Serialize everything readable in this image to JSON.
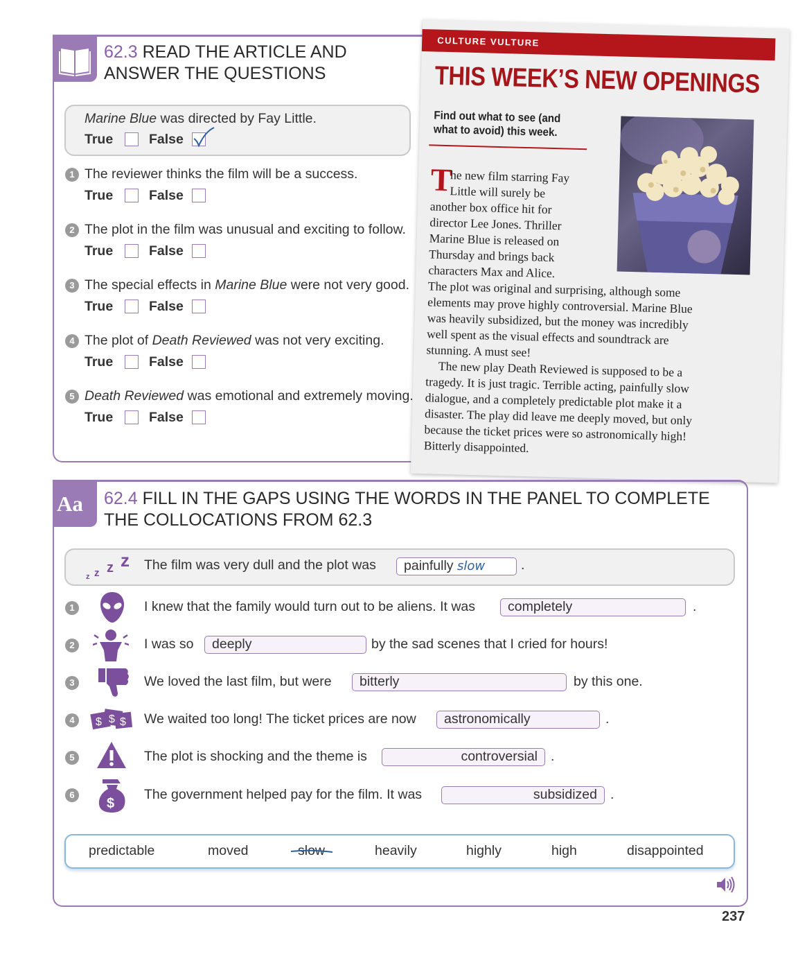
{
  "sec623": {
    "number": "62.3",
    "title_line1": "READ THE ARTICLE AND",
    "title_line2": "ANSWER THE QUESTIONS",
    "true_label": "True",
    "false_label": "False",
    "example": {
      "italic": "Marine Blue",
      "rest": " was directed by Fay Little.",
      "answer": "False"
    },
    "questions": [
      {
        "num": "1",
        "pre": "The reviewer thinks the film will be a success.",
        "italic": "",
        "post": ""
      },
      {
        "num": "2",
        "pre": "The plot in the film was unusual and exciting to follow.",
        "italic": "",
        "post": ""
      },
      {
        "num": "3",
        "pre": "The special effects in ",
        "italic": "Marine Blue",
        "post": " were not very good."
      },
      {
        "num": "4",
        "pre": "The plot of ",
        "italic": "Death Reviewed",
        "post": " was not very exciting."
      },
      {
        "num": "5",
        "pre": "",
        "italic": "Death Reviewed",
        "post": " was emotional and extremely moving."
      }
    ]
  },
  "article": {
    "banner": "CULTURE VULTURE",
    "headline": "THIS WEEK’S NEW OPENINGS",
    "standfirst": "Find out what to see (and what to avoid) this week.",
    "dropcap": "T",
    "p1_lines": [
      "he new film starring Fay",
      "Little will surely be",
      "another box office hit for",
      "director Lee Jones. Thriller",
      "Marine Blue is released on",
      "Thursday and brings back",
      "characters Max and Alice."
    ],
    "p2_lines": [
      "The plot was original and surprising, although some",
      "elements may prove highly controversial. Marine Blue",
      "was heavily subsidized, but the money was incredibly",
      "well spent as the visual effects and soundtrack are",
      "stunning. A must see!"
    ],
    "p3_lines": [
      "The new play Death Reviewed is supposed to be a",
      "tragedy. It is just tragic. Terrible acting, painfully slow",
      "dialogue, and a completely predictable plot make it a",
      "disaster. The play did leave me deeply moved, but only",
      "because the ticket prices were so astronomically high!",
      "Bitterly disappointed."
    ]
  },
  "sec624": {
    "tab_label": "Aa",
    "number": "62.4",
    "title_line1": "FILL IN THE GAPS USING THE WORDS IN THE PANEL TO COMPLETE",
    "title_line2": "THE COLLOCATIONS FROM 62.3",
    "example": {
      "text": "The film was very dull and the plot was",
      "answer_prefix": "painfully",
      "answer": "slow",
      "end": "."
    },
    "items": [
      {
        "num": "1",
        "before": "I knew that the family would turn out to be aliens. It was",
        "gap": "completely",
        "after": "."
      },
      {
        "num": "2",
        "before": "I was so",
        "gap": "deeply",
        "after": "by the sad scenes that I cried for hours!"
      },
      {
        "num": "3",
        "before": "We loved the last film, but were",
        "gap": "bitterly",
        "after": "by this one."
      },
      {
        "num": "4",
        "before": "We waited too long! The ticket prices are now",
        "gap": "astronomically",
        "after": "."
      },
      {
        "num": "5",
        "before": "The plot is shocking and the theme is",
        "gap": "controversial",
        "after": "."
      },
      {
        "num": "6",
        "before": "The government helped pay for the film. It was",
        "gap": "subsidized",
        "after": "."
      }
    ],
    "panel_words": [
      "predictable",
      "moved",
      "slow",
      "heavily",
      "highly",
      "high",
      "disappointed"
    ],
    "crossed_word": "slow"
  },
  "page_number": "237",
  "icons": [
    "book-icon",
    "sleep-zzz-icon",
    "alien-icon",
    "crying-person-icon",
    "thumbs-down-icon",
    "money-icon",
    "warning-icon",
    "money-bag-icon",
    "speaker-icon"
  ],
  "colors": {
    "accent": "#9b7bb6",
    "banner_red": "#b5161b",
    "panel_blue": "#8bb7d6"
  }
}
